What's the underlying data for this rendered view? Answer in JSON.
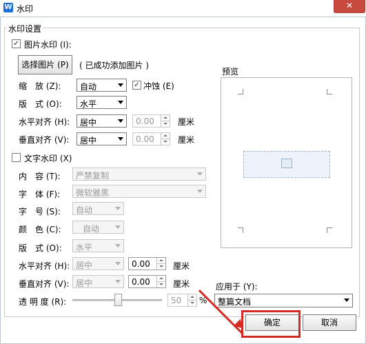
{
  "window": {
    "title": "水印",
    "close_glyph": "✕",
    "app_icon_letter": "W"
  },
  "group_title": "水印设置",
  "picture": {
    "checkbox_label": "图片水印 (I):",
    "checked": true,
    "select_button": "选择图片 (P)",
    "status": "( 已成功添加图片 )",
    "scale_label": "缩　放 (Z):",
    "scale_value": "自动",
    "washout_label": "冲蚀 (E)",
    "washout_checked": true,
    "layout_label": "版　式 (O):",
    "layout_value": "水平",
    "halign_label": "水平对齐 (H):",
    "halign_value": "居中",
    "halign_offset": "0.00",
    "valign_label": "垂直对齐 (V):",
    "valign_value": "居中",
    "valign_offset": "0.00",
    "unit": "厘米"
  },
  "text": {
    "checkbox_label": "文字水印 (X)",
    "checked": false,
    "content_label": "内　容 (T):",
    "content_value": "严禁复制",
    "font_label": "字　体 (F):",
    "font_value": "微软雅黑",
    "size_label": "字　号 (S):",
    "size_value": "自动",
    "color_label": "颜　色 (C):",
    "color_value": "自动",
    "layout_label": "版　式 (O):",
    "layout_value": "水平",
    "halign_label": "水平对齐 (H):",
    "halign_value": "居中",
    "halign_offset": "0.00",
    "valign_label": "垂直对齐 (V):",
    "valign_value": "居中",
    "valign_offset": "0.00",
    "unit": "厘米",
    "transparency_label": "透 明 度 (R):",
    "transparency_value": "50",
    "percent": "%"
  },
  "preview": {
    "label": "预览"
  },
  "apply": {
    "label": "应用于 (Y):",
    "value": "整篇文档"
  },
  "buttons": {
    "ok": "确定",
    "cancel": "取消"
  },
  "colors": {
    "accent": "#1e6fd9",
    "close": "#c8493e",
    "highlight": "#d42a23"
  }
}
